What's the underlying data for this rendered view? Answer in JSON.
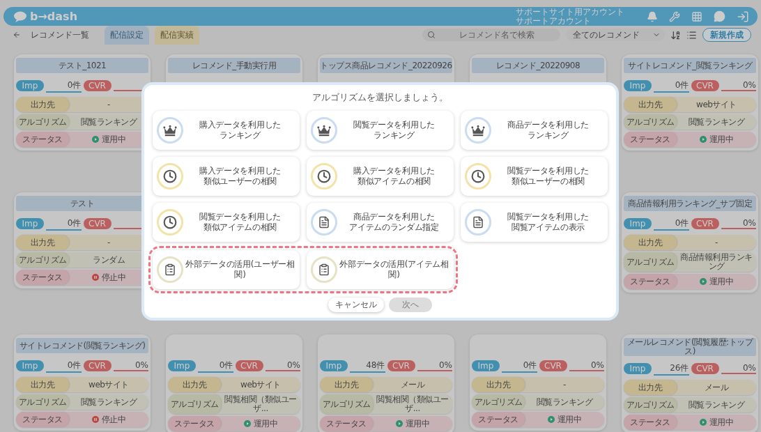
{
  "header": {
    "logo": "b→dash",
    "account_lines": [
      "サポートサイト用アカウント",
      "サポートアカウント"
    ]
  },
  "subbar": {
    "page_title": "レコメンド一覧",
    "tabs": [
      {
        "label": "配信設定",
        "selected": true
      },
      {
        "label": "配信実績",
        "selected": false
      }
    ],
    "search": {
      "placeholder": "レコメンド名で検索"
    },
    "filter": {
      "value": "全てのレコメンド"
    },
    "new_button": "新規作成"
  },
  "card_rows": [
    [
      {
        "title": "テスト_1021",
        "imp": {
          "label": "Imp",
          "value": "0件"
        },
        "cvr": {
          "label": "CVR"
        },
        "output": {
          "label": "出力先",
          "value": "-"
        },
        "algorithm": {
          "label": "アルゴリズム",
          "value": "閲覧ランキング"
        },
        "status": {
          "label": "ステータス",
          "value": "運用中",
          "kind": "running"
        }
      },
      {
        "title": "レコメンド_手動実行用"
      },
      {
        "title": "トップス商品レコメンド_20220926"
      },
      {
        "title": "レコメンド_20220908"
      },
      {
        "title": "サイトレコメンド_閲覧ランキング",
        "imp": {
          "label": "Imp",
          "value": "0件"
        },
        "cvr": {
          "label": "CVR",
          "value": "0%"
        },
        "output": {
          "label": "出力先",
          "value": "webサイト"
        },
        "algorithm": {
          "label": "アルゴリズム",
          "value": "閲覧ランキング"
        },
        "status": {
          "label": "ステータス",
          "value": "運用中",
          "kind": "running"
        }
      }
    ],
    [
      {
        "title": "テスト",
        "imp": {
          "label": "Imp",
          "value": "0件"
        },
        "cvr": {
          "label": "CVR"
        },
        "output": {
          "label": "出力先",
          "value": "-"
        },
        "algorithm": {
          "label": "アルゴリズム",
          "value": "ランダム"
        },
        "status": {
          "label": "ステータス",
          "value": "停止中",
          "kind": "paused"
        }
      },
      {
        "title": "商品情報利用ランキング_サブ固定",
        "imp": {
          "label": "Imp",
          "value": "0件"
        },
        "cvr": {
          "label": "CVR",
          "value": "0%"
        },
        "output": {
          "label": "出力先",
          "value": "-"
        },
        "algorithm": {
          "label": "アルゴリズム",
          "value": "商品情報利用ランキング"
        },
        "status": {
          "label": "ステータス",
          "value": "運用中",
          "kind": "running"
        }
      }
    ],
    [
      {
        "title": "サイトレコメンド(閲覧ランキング)",
        "imp": {
          "label": "Imp",
          "value": "0件"
        },
        "cvr": {
          "label": "CVR",
          "value": "0%"
        },
        "output": {
          "label": "出力先",
          "value": "webサイト"
        },
        "algorithm": {
          "label": "アルゴリズム",
          "value": "閲覧ランキング"
        },
        "status": {
          "label": "ステータス",
          "value": "停止中",
          "kind": "paused"
        }
      },
      {
        "imp": {
          "label": "Imp",
          "value": "0件"
        },
        "cvr": {
          "label": "CVR",
          "value": "0%"
        },
        "output": {
          "label": "出力先",
          "value": "webサイト"
        },
        "algorithm": {
          "label": "アルゴリズム",
          "value": "閲覧相関（類似ユーザ..."
        },
        "status": {
          "label": "ステータス",
          "value": "運用中",
          "kind": "running"
        }
      },
      {
        "imp": {
          "label": "Imp",
          "value": "48件"
        },
        "cvr": {
          "label": "CVR",
          "value": "0%"
        },
        "output": {
          "label": "出力先",
          "value": "メール"
        },
        "algorithm": {
          "label": "アルゴリズム",
          "value": "閲覧相関（類似ユーザ..."
        },
        "status": {
          "label": "ステータス",
          "value": "運用中",
          "kind": "running"
        }
      },
      {
        "imp": {
          "label": "Imp",
          "value": "0件"
        },
        "cvr": {
          "label": "CVR",
          "value": "0%"
        },
        "output": {
          "label": "出力先",
          "value": "-"
        },
        "algorithm": {
          "label": "アルゴリズム",
          "value": "閲覧ランキング"
        },
        "status": {
          "label": "ステータス",
          "value": "運用中",
          "kind": "running"
        }
      },
      {
        "title": "メールレコメンド(閲覧履歴:トップス)",
        "imp": {
          "label": "Imp",
          "value": "26件"
        },
        "cvr": {
          "label": "CVR",
          "value": "0%"
        },
        "output": {
          "label": "出力先",
          "value": "メール"
        },
        "algorithm": {
          "label": "アルゴリズム",
          "value": "閲覧ランキング"
        },
        "status": {
          "label": "ステータス",
          "value": "運用中",
          "kind": "running"
        }
      }
    ]
  ],
  "modal": {
    "title": "アルゴリズムを選択しましょう。",
    "options": [
      {
        "lines": [
          "購入データを利用した",
          "ランキング"
        ],
        "kind": "crown",
        "highlighted": false
      },
      {
        "lines": [
          "閲覧データを利用した",
          "ランキング"
        ],
        "kind": "crown",
        "highlighted": false
      },
      {
        "lines": [
          "商品データを利用した",
          "ランキング"
        ],
        "kind": "crown",
        "highlighted": false
      },
      {
        "lines": [
          "購入データを利用した",
          "類似ユーザーの相関"
        ],
        "kind": "clock",
        "highlighted": false
      },
      {
        "lines": [
          "購入データを利用した",
          "類似アイテムの相関"
        ],
        "kind": "clock",
        "highlighted": false
      },
      {
        "lines": [
          "閲覧データを利用した",
          "類似ユーザーの相関"
        ],
        "kind": "clock",
        "highlighted": false
      },
      {
        "lines": [
          "閲覧データを利用した",
          "類似アイテムの相関"
        ],
        "kind": "clock",
        "highlighted": false
      },
      {
        "lines": [
          "商品データを利用した",
          "アイテムのランダム指定"
        ],
        "kind": "document",
        "highlighted": false
      },
      {
        "lines": [
          "閲覧データを利用した",
          "閲覧アイテムの表示"
        ],
        "kind": "document",
        "highlighted": false
      },
      {
        "lines": [
          "外部データの活用(ユーザー相関)"
        ],
        "kind": "clipboard",
        "highlighted": true
      },
      {
        "lines": [
          "外部データの活用(アイテム相関)"
        ],
        "kind": "clipboard",
        "highlighted": true
      }
    ],
    "buttons": [
      {
        "label": "キャンセル",
        "disabled": false
      },
      {
        "label": "次へ",
        "disabled": true
      }
    ]
  }
}
